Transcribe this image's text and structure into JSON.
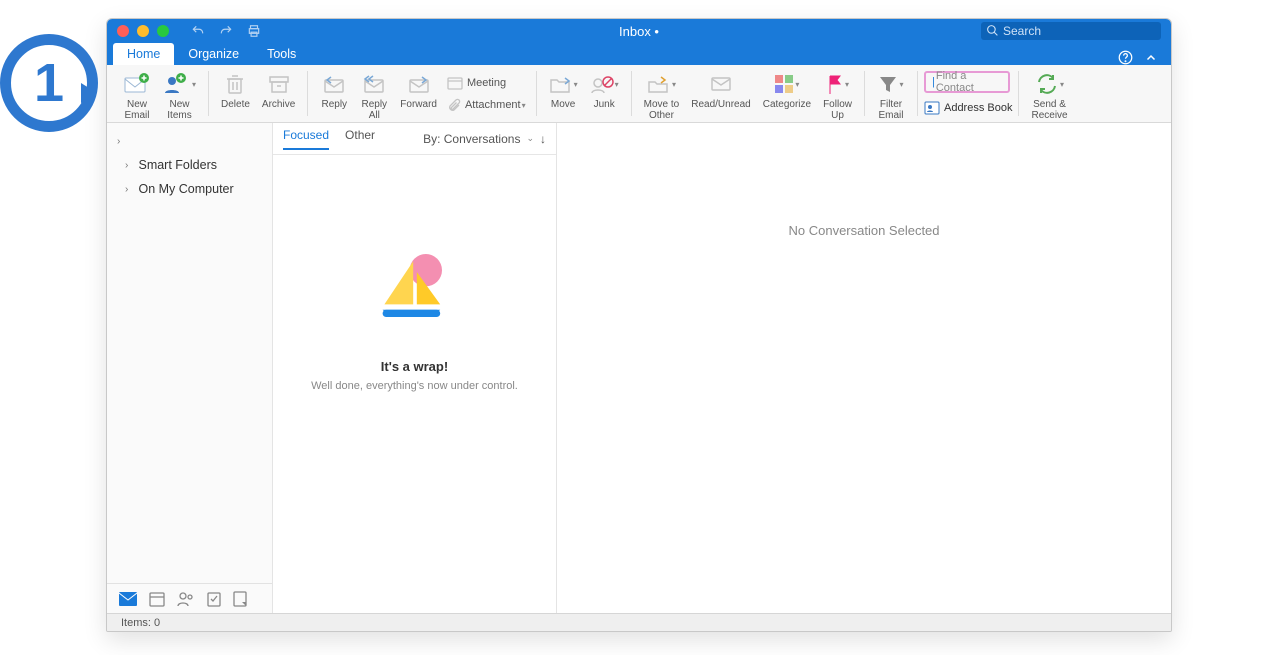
{
  "window": {
    "title": "Inbox •"
  },
  "search": {
    "placeholder": "Search"
  },
  "tabs": {
    "home": "Home",
    "organize": "Organize",
    "tools": "Tools"
  },
  "ribbon": {
    "new_email": "New\nEmail",
    "new_items": "New\nItems",
    "delete": "Delete",
    "archive": "Archive",
    "reply": "Reply",
    "reply_all": "Reply\nAll",
    "forward": "Forward",
    "meeting": "Meeting",
    "attachment": "Attachment",
    "move": "Move",
    "junk": "Junk",
    "move_to_other": "Move to\nOther",
    "read_unread": "Read/Unread",
    "categorize": "Categorize",
    "follow_up": "Follow\nUp",
    "filter_email": "Filter\nEmail",
    "find_contact_placeholder": "Find a Contact",
    "address_book": "Address Book",
    "send_receive": "Send &\nReceive"
  },
  "sidebar": {
    "smart_folders": "Smart Folders",
    "on_my_computer": "On My Computer"
  },
  "list": {
    "tab_focused": "Focused",
    "tab_other": "Other",
    "sort_label": "By: Conversations",
    "empty_title": "It's a wrap!",
    "empty_sub": "Well done, everything's now under control."
  },
  "reading": {
    "empty": "No Conversation Selected"
  },
  "status": {
    "text": "Items: 0"
  },
  "callout": {
    "num": "1"
  }
}
